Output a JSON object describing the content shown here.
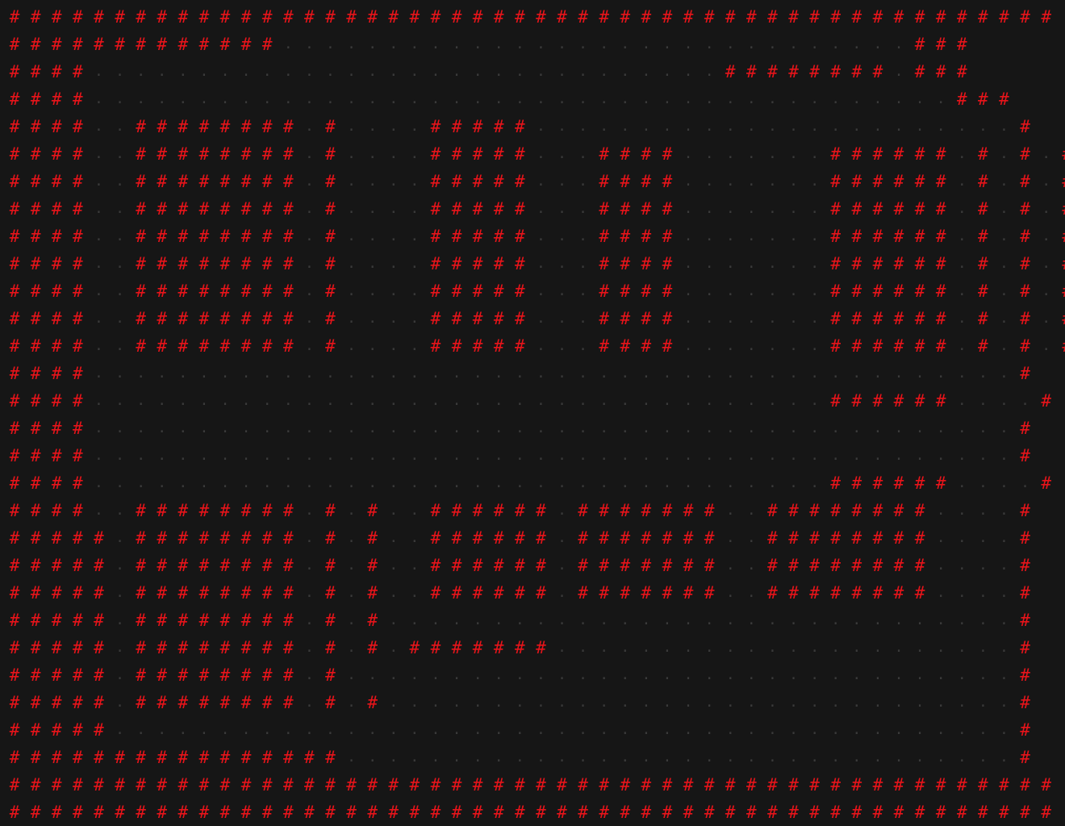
{
  "map": {
    "wall_char": "#",
    "floor_char": ".",
    "wall_color": "#e8141a",
    "floor_color": "#3a3a3a",
    "background_color": "#161616",
    "rows": [
      "##################################################",
      "#############..............................###",
      "####..............................########.###",
      "####.........................................###",
      "####..########.#....#####.......................#",
      "####..########.#....#####...####.......######.#.#.#",
      "####..########.#....#####...####.......######.#.#.#",
      "####..########.#....#####...####.......######.#.#.#",
      "####..########.#....#####...####.......######.#.#.#",
      "####..########.#....#####...####.......######.#.#.#",
      "####..########.#....#####...####.......######.#.#.#",
      "####..########.#....#####...####.......######.#.#.#",
      "####..########.#....#####...####.......######.#.#.#",
      "####............................................#",
      "####...................................######....#",
      "####............................................#",
      "####............................................#",
      "####...................................######....#",
      "####..########.#.#..######.#######..########....#",
      "#####.########.#.#..######.#######..########....#",
      "#####.########.#.#..######.#######..########....#",
      "#####.########.#.#..######.#######..########....#",
      "#####.########.#.#..............................#",
      "#####.########.#.#.#######......................#",
      "#####.########.#................................#",
      "#####.########.#.#..............................#",
      "#####...........................................#",
      "################................................#",
      "##################################################",
      "##################################################"
    ]
  }
}
